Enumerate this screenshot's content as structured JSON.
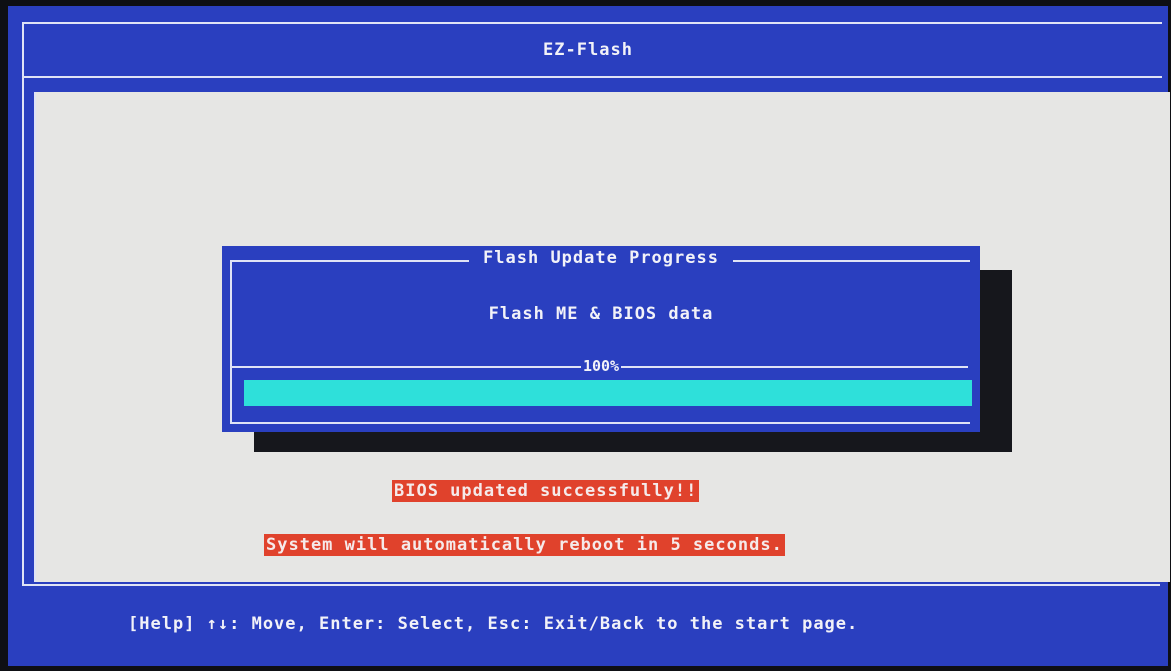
{
  "window": {
    "title": "EZ-Flash"
  },
  "dialog": {
    "title": "Flash Update Progress",
    "subtitle": "Flash ME & BIOS data",
    "progress_label": "100%",
    "progress_fraction": 1.0
  },
  "messages": {
    "success": "BIOS updated successfully!!",
    "reboot": "System will automatically reboot in 5 seconds."
  },
  "help_bar": {
    "text": "[Help] ↑↓: Move, Enter: Select, Esc: Exit/Back to the start page."
  },
  "colors": {
    "bios_blue": "#2a3fbf",
    "progress_cyan": "#2ee0da",
    "alert_red": "#e0422c",
    "workarea_gray": "#e6e6e4"
  }
}
